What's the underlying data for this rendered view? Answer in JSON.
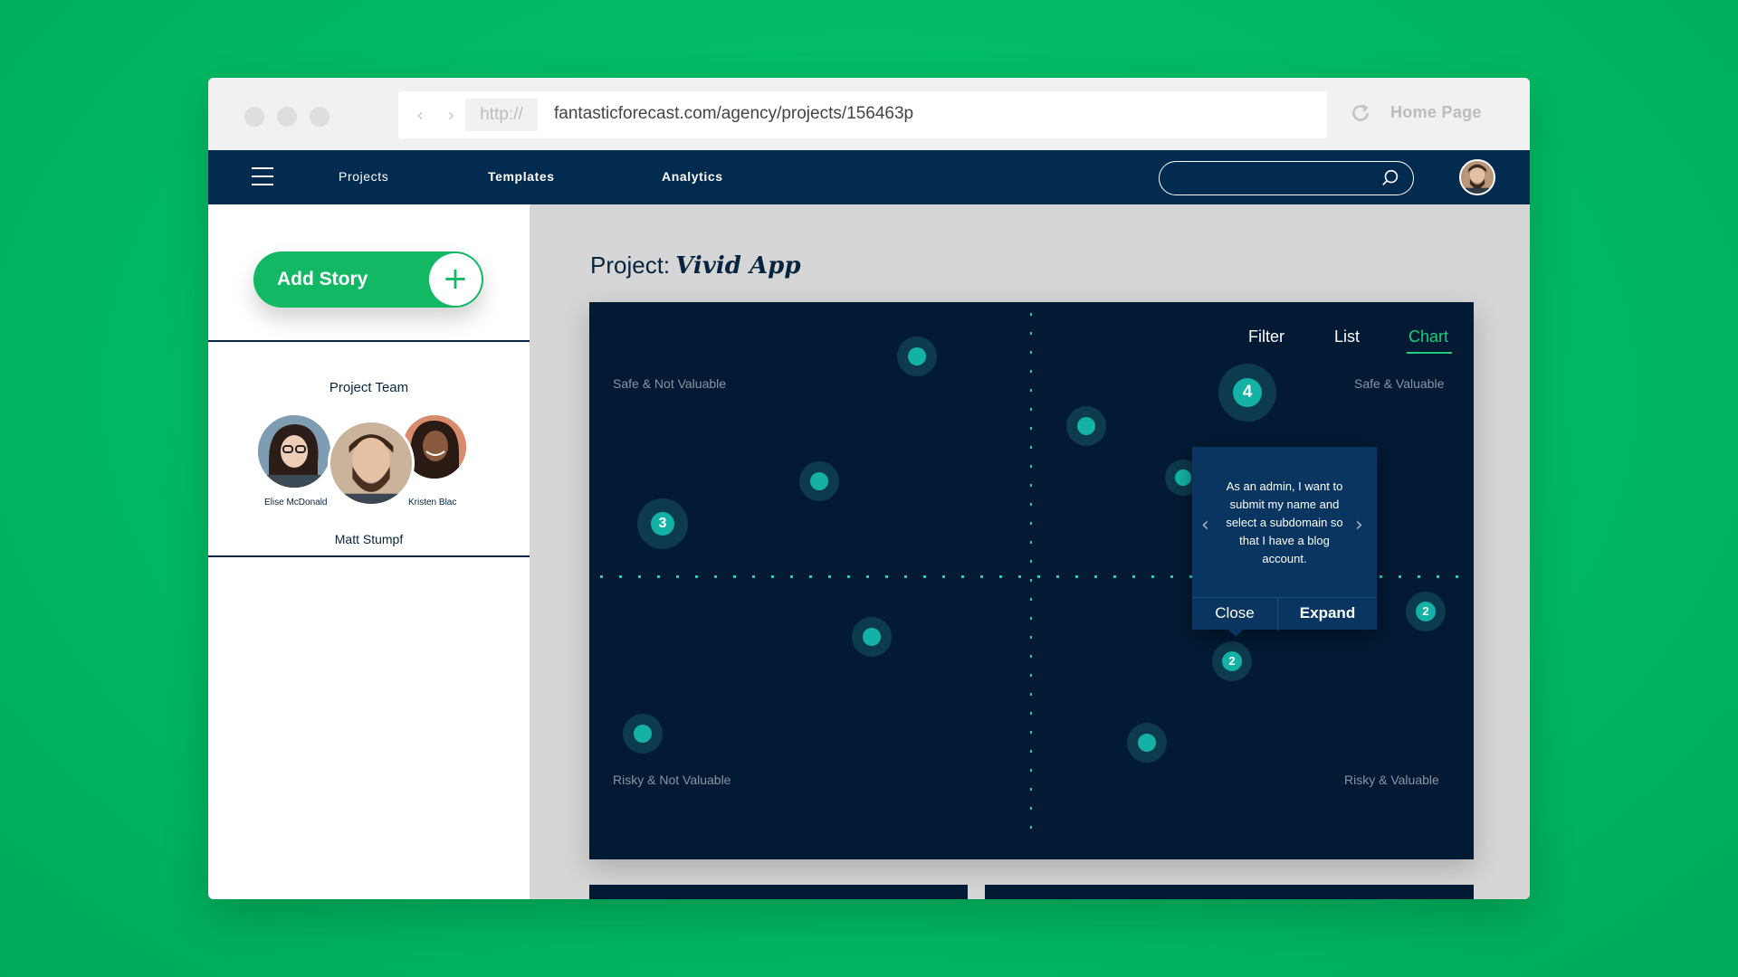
{
  "browser": {
    "protocol": "http://",
    "url": "fantasticforecast.com/agency/projects/156463p",
    "home_label": "Home Page"
  },
  "nav": {
    "items": [
      "Projects",
      "Templates",
      "Analytics"
    ]
  },
  "sidebar": {
    "add_story_label": "Add Story",
    "team_title": "Project Team",
    "members": [
      "Elise McDonald",
      "Matt Stumpf",
      "Kristen Blac"
    ]
  },
  "main": {
    "title_prefix": "Project:",
    "project_name": "Vivid App",
    "view_tabs": [
      "Filter",
      "List",
      "Chart"
    ],
    "active_tab": "Chart",
    "quadrants": {
      "top_left": "Safe & Not Valuable",
      "top_right": "Safe & Valuable",
      "bottom_left": "Risky  & Not Valuable",
      "bottom_right": "Risky  & Valuable"
    },
    "points": [
      {
        "label": ""
      },
      {
        "label": "4"
      },
      {
        "label": ""
      },
      {
        "label": ""
      },
      {
        "label": "3"
      },
      {
        "label": ""
      },
      {
        "label": "2"
      },
      {
        "label": "2"
      },
      {
        "label": ""
      },
      {
        "label": ""
      },
      {
        "label": ""
      }
    ],
    "popover": {
      "text": "As an admin, I want to submit my name and select a subdomain so that I have a blog account.",
      "close_label": "Close",
      "expand_label": "Expand"
    }
  },
  "colors": {
    "background": "#00b862",
    "nav": "#032a4f",
    "panel": "#021a33",
    "accent_green": "#1ccd7a",
    "point": "#14b2a6"
  }
}
